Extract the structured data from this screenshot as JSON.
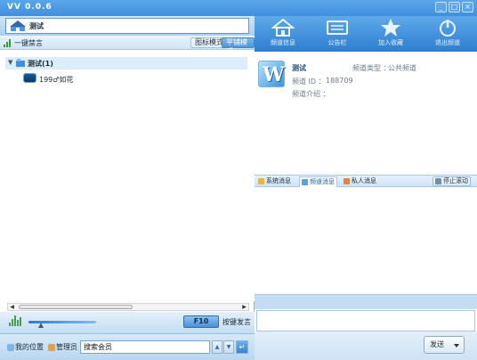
{
  "window": {
    "title": "VV  0.0.6",
    "controls": {
      "minimize": "_",
      "maximize": "□",
      "close": "×"
    }
  },
  "channel_header": {
    "name": "测试"
  },
  "mode_bar": {
    "mute_label": "一键禁言",
    "icon_mode_label": "图标模式",
    "tree_mode_label": "平铺模式"
  },
  "tree": {
    "root": {
      "label": "测试(1)",
      "expanded": true
    },
    "users": [
      {
        "label": "199♂如花"
      }
    ]
  },
  "voice_bar": {
    "hotkey": "F10",
    "hotkey_label": "按键发言",
    "volume_level": 0.18
  },
  "search_bar": {
    "my_location_label": "我的位置",
    "manager_label": "管理员",
    "search_value": "搜索会员"
  },
  "toolbar": {
    "items": [
      {
        "label": "频道信息",
        "icon": "house-icon"
      },
      {
        "label": "公告栏",
        "icon": "notice-board-icon"
      },
      {
        "label": "加入收藏",
        "icon": "star-icon"
      },
      {
        "label": "退出频道",
        "icon": "power-icon"
      }
    ]
  },
  "channel_info": {
    "logo_letter": "W",
    "name": "测试",
    "type_label": "频道类型 ：",
    "type_value": "公共频道",
    "id_label": "频道 ID ：",
    "id_value": "188709",
    "intro_label": "频道介绍 ："
  },
  "message_tabs": {
    "system": "系统消息",
    "channel": "频道消息",
    "private": "私人消息",
    "stop_scroll": "停止滚动",
    "active": "channel"
  },
  "send": {
    "label": "发送"
  },
  "colors": {
    "titlebar": "#4a9be4",
    "toolbar": "#3e8bd8",
    "selection": "#dceefc",
    "panel": "#cfe3f5"
  }
}
